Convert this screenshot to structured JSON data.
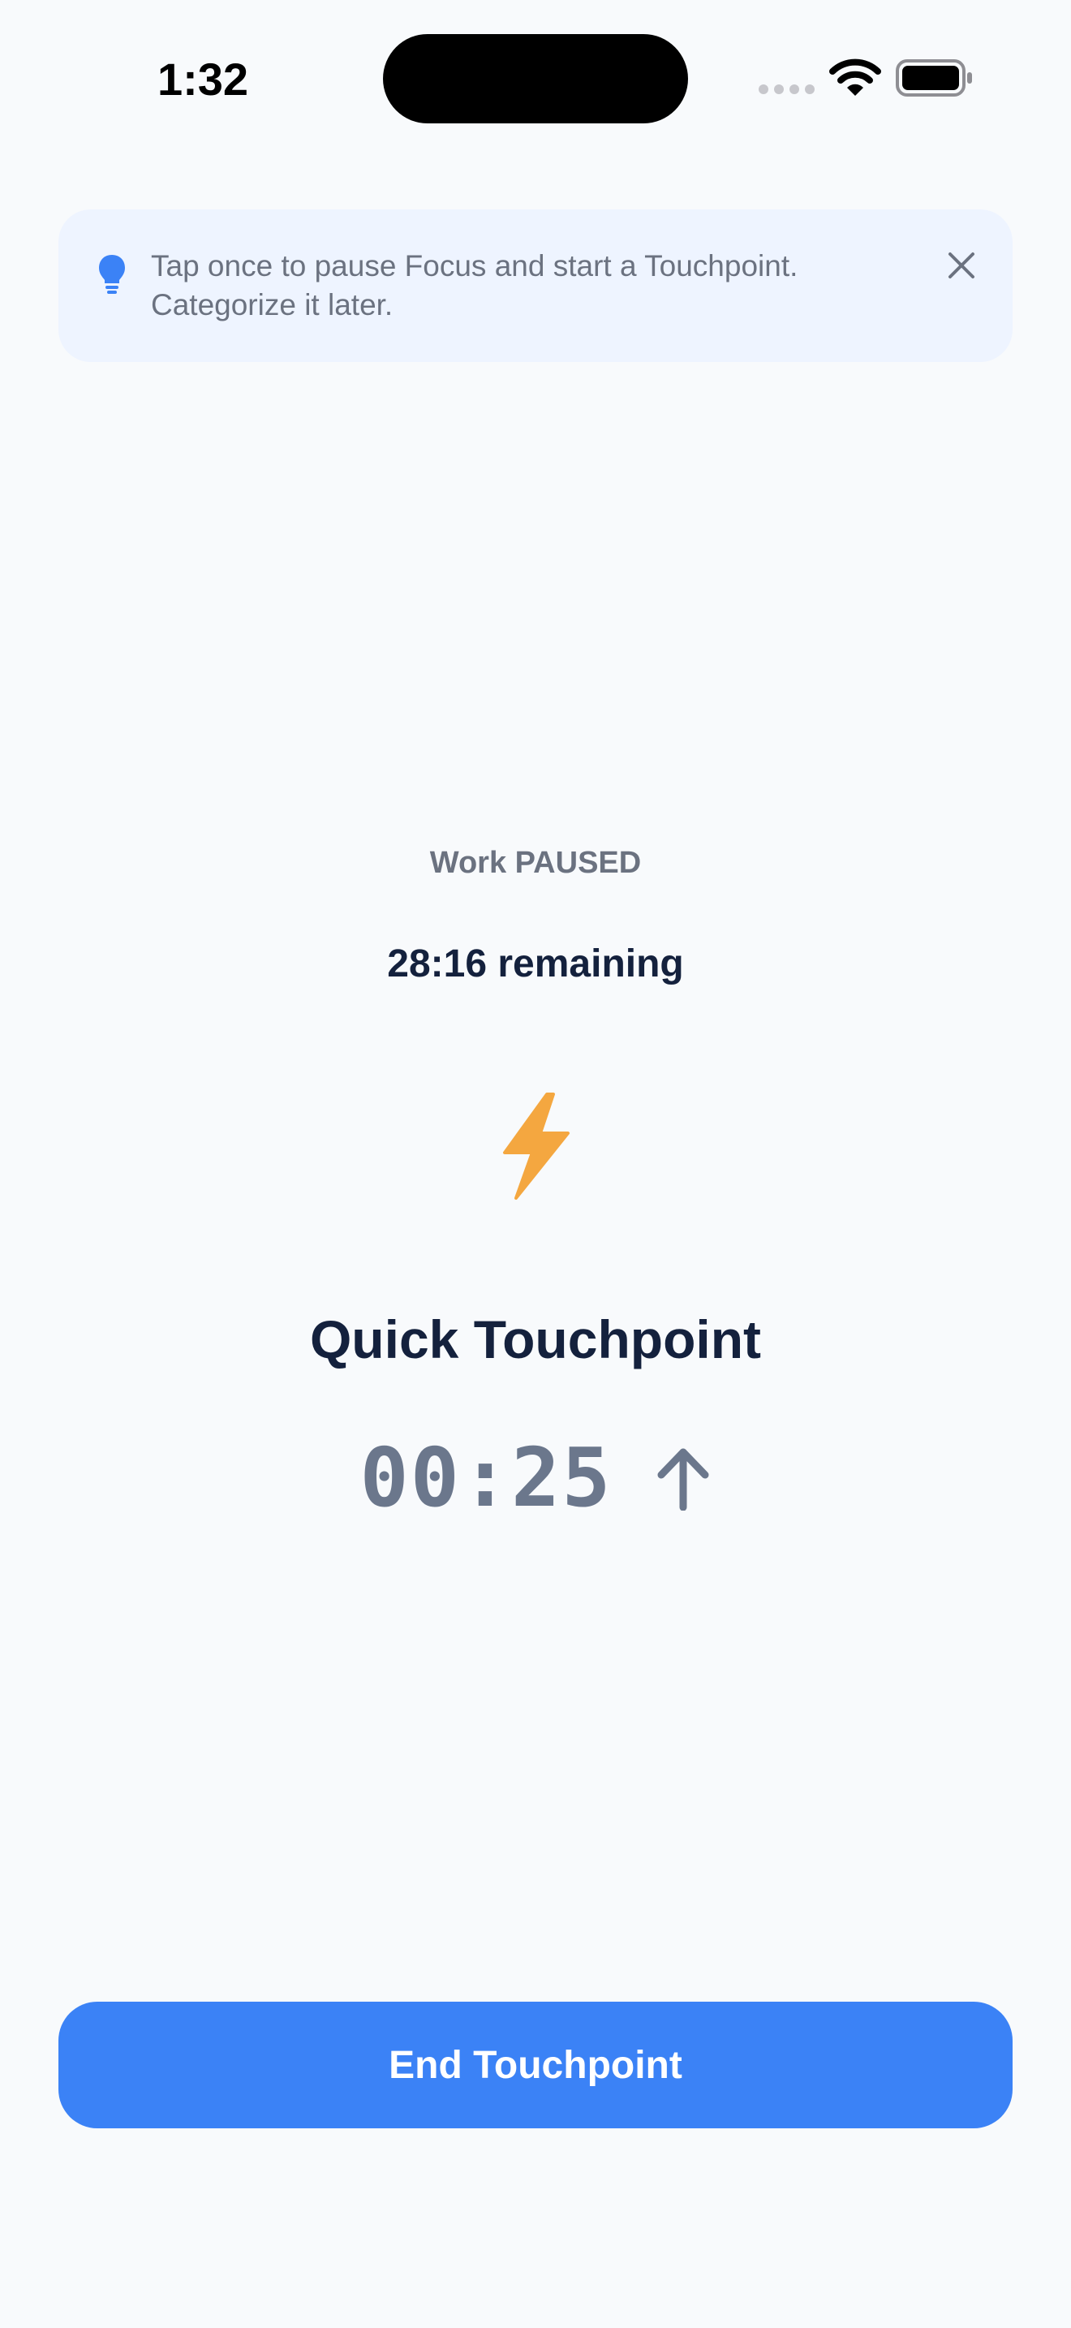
{
  "status_bar": {
    "time": "1:32",
    "icons": [
      "cellular-signal-icon",
      "wifi-icon",
      "battery-icon"
    ]
  },
  "tip": {
    "icon": "lightbulb-icon",
    "text": "Tap once to pause Focus and start a Touchpoint. Categorize it later.",
    "close_icon": "close-icon"
  },
  "session": {
    "paused_label": "Work PAUSED",
    "remaining": "28:16 remaining"
  },
  "touchpoint": {
    "icon": "lightning-bolt-icon",
    "title": "Quick Touchpoint",
    "elapsed": "00:25",
    "direction_icon": "arrow-up-icon"
  },
  "actions": {
    "end_label": "End Touchpoint"
  },
  "colors": {
    "background": "#f8fafc",
    "accent": "#3b82f6",
    "bolt": "#f4a740",
    "tip_background": "#eef4ff",
    "primary_text": "#14213d",
    "secondary_text": "#6b7280"
  }
}
